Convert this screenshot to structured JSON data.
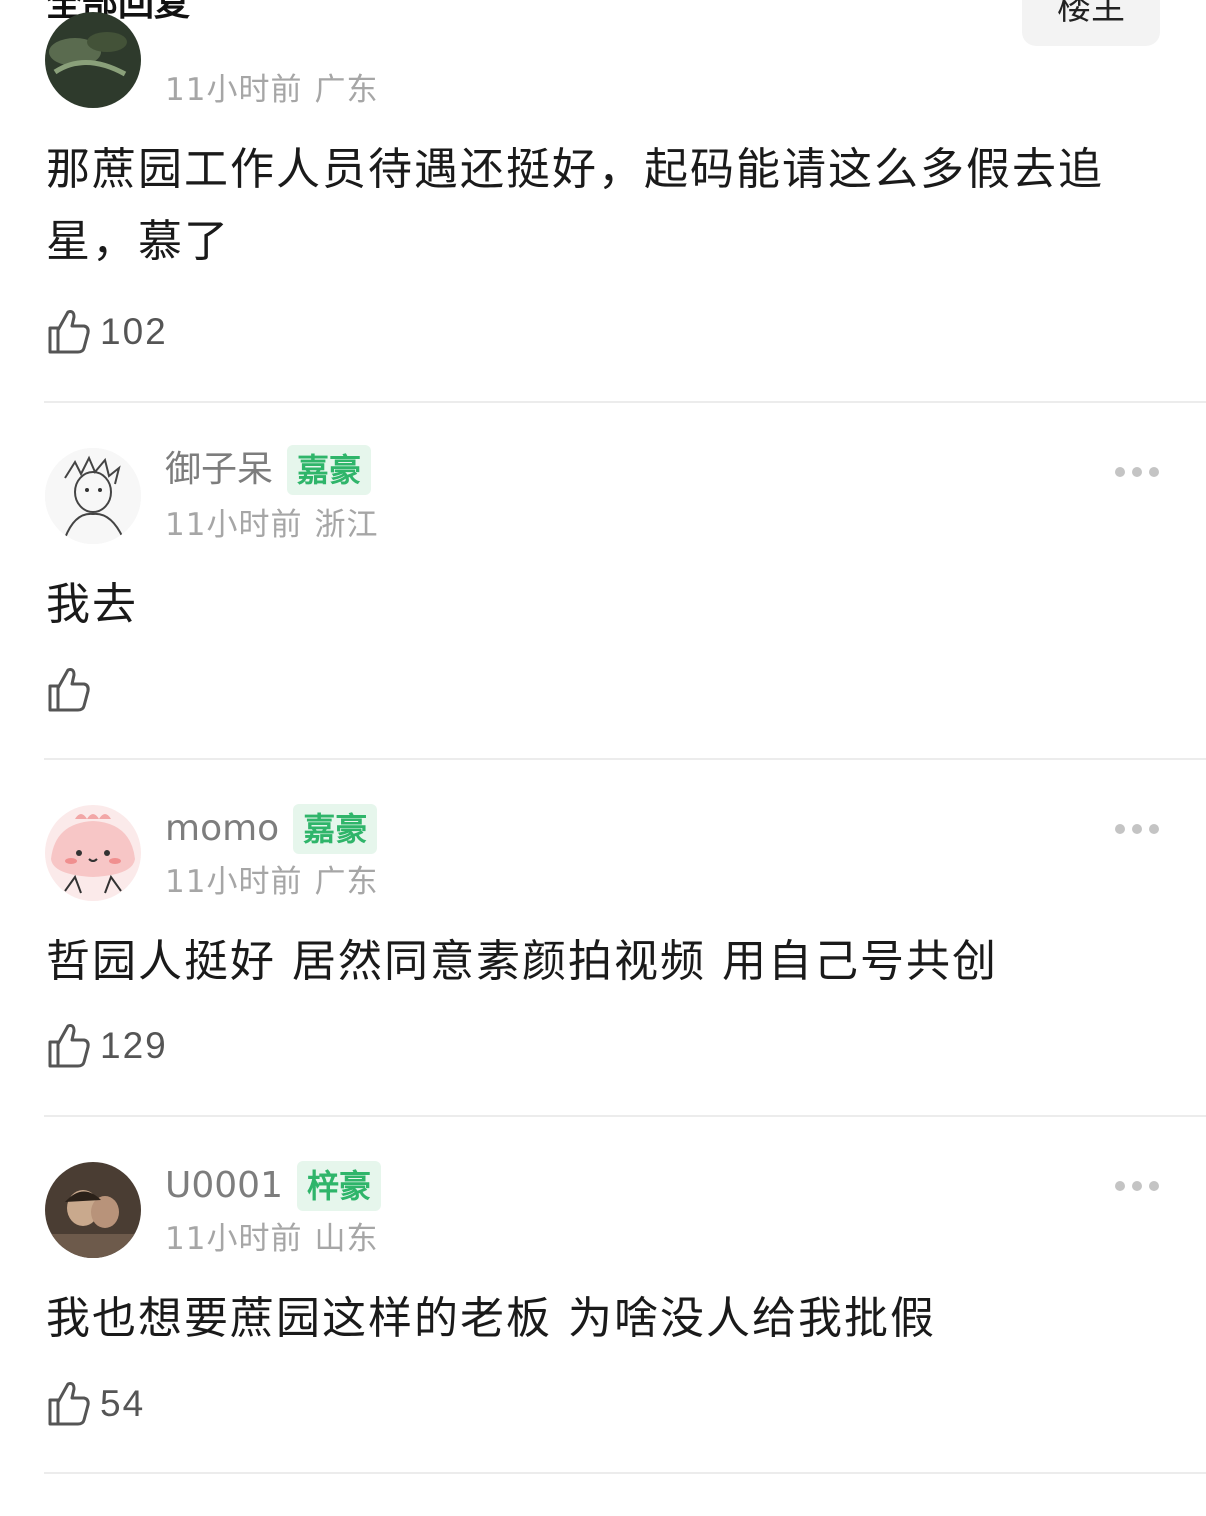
{
  "header": {
    "section_title": "全部回复",
    "owner_filter_label": "楼主"
  },
  "comments": [
    {
      "username": "",
      "badge": "",
      "time": "11小时前",
      "region": "广东",
      "text": "那蔗园工作人员待遇还挺好，起码能请这么多假去追星，慕了",
      "likes": "102"
    },
    {
      "username": "御子呆",
      "badge": "嘉豪",
      "time": "11小时前",
      "region": "浙江",
      "text": "我去",
      "likes": ""
    },
    {
      "username": "momo",
      "badge": "嘉豪",
      "time": "11小时前",
      "region": "广东",
      "text": "哲园人挺好 居然同意素颜拍视频 用自己号共创",
      "likes": "129"
    },
    {
      "username": "U0001",
      "badge": "梓豪",
      "time": "11小时前",
      "region": "山东",
      "text": "我也想要蔗园这样的老板 为啥没人给我批假",
      "likes": "54"
    }
  ],
  "colors": {
    "badge_bg": "#e6f6ec",
    "badge_text": "#2fb56a",
    "meta_text": "#a6a6a6",
    "divider": "#ececec"
  },
  "icons": {
    "like": "thumbs-up-icon",
    "more": "more-dots-icon"
  }
}
